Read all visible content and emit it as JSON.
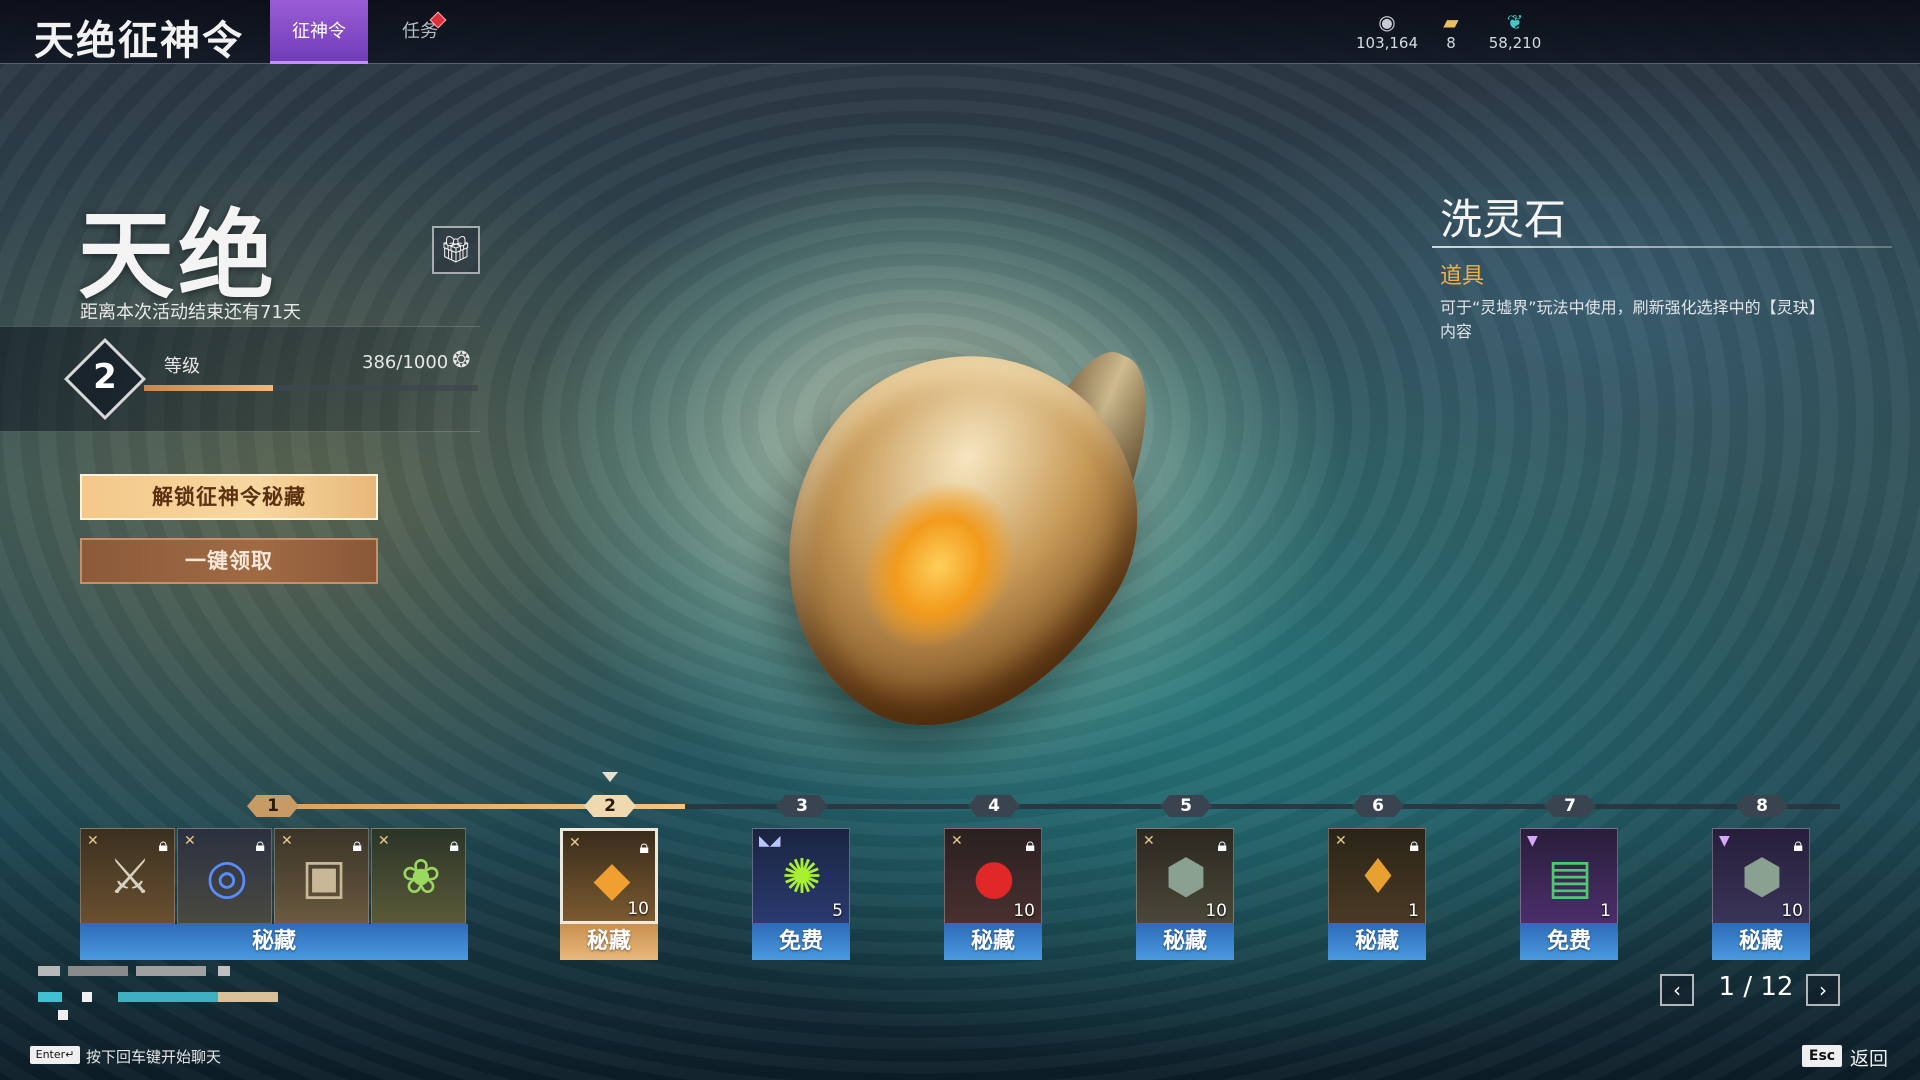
{
  "header": {
    "title": "天绝征神令",
    "tabs": [
      {
        "label": "征神令",
        "active": true
      },
      {
        "label": "任务",
        "active": false,
        "has_notification": true
      }
    ],
    "currencies": [
      {
        "icon": "coin-icon",
        "value": "103,164"
      },
      {
        "icon": "ticket-icon",
        "value": "8"
      },
      {
        "icon": "feather-icon",
        "value": "58,210"
      }
    ]
  },
  "season": {
    "title": "天绝",
    "countdown": "距离本次活动结束还有71天",
    "level_label": "等级",
    "level": "2",
    "xp_text": "386/1000",
    "xp_progress": 0.386
  },
  "buttons": {
    "unlock": "解锁征神令秘藏",
    "claim_all": "一键领取"
  },
  "item_detail": {
    "name": "洗灵石",
    "type": "道具",
    "description": "可于“灵墟界”玩法中使用，刷新强化选择中的【灵玦】内容"
  },
  "track": {
    "progress_level": 2,
    "nodes": [
      "1",
      "2",
      "3",
      "4",
      "5",
      "6",
      "7",
      "8"
    ],
    "rewards": [
      {
        "level": "1",
        "label": "秘藏",
        "type": "premium-group",
        "icons": [
          "sword-icon",
          "ring-icon",
          "chest-icon",
          "plant-icon"
        ],
        "locked": true
      },
      {
        "level": "2",
        "label": "秘藏",
        "icon": "stone-icon",
        "qty": "10",
        "locked": true,
        "selected": true
      },
      {
        "level": "3",
        "label": "免费",
        "icon": "orb-icon",
        "qty": "5",
        "locked": false
      },
      {
        "level": "4",
        "label": "秘藏",
        "icon": "red-orb-icon",
        "qty": "10",
        "locked": true
      },
      {
        "level": "5",
        "label": "秘藏",
        "icon": "dice-icon",
        "qty": "10",
        "locked": true
      },
      {
        "level": "6",
        "label": "秘藏",
        "icon": "pouch-icon",
        "qty": "1",
        "locked": true
      },
      {
        "level": "7",
        "label": "免费",
        "icon": "scroll-icon",
        "qty": "1",
        "locked": false
      },
      {
        "level": "8",
        "label": "秘藏",
        "icon": "dice-icon",
        "qty": "10",
        "locked": true
      }
    ]
  },
  "pagination": {
    "text": "1 / 12"
  },
  "footer": {
    "enter_key": "Enter↵",
    "chat_hint": "按下回车键开始聊天",
    "esc_key": "Esc",
    "back_label": "返回"
  }
}
